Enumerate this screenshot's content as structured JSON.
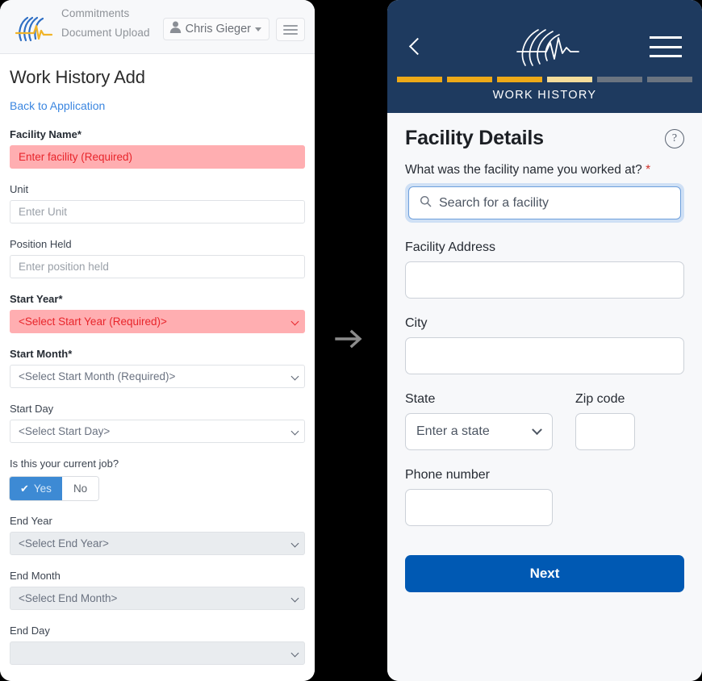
{
  "desktop": {
    "topbar": {
      "logo_name": "brand-logo",
      "nav_links": [
        {
          "label": "Commitments"
        },
        {
          "label": "Document Upload"
        }
      ],
      "user_name": "Chris Gieger",
      "menu_name": "menu-icon"
    },
    "page_title": "Work History Add",
    "back_link": "Back to Application",
    "fields": [
      {
        "label": "Facility Name",
        "required": true,
        "type": "text",
        "value": "",
        "placeholder": "Enter facility (Required)",
        "state": "error"
      },
      {
        "label": "Unit",
        "required": false,
        "type": "text",
        "value": "",
        "placeholder": "Enter Unit",
        "state": "normal"
      },
      {
        "label": "Position Held",
        "required": false,
        "type": "text",
        "value": "",
        "placeholder": "Enter position held",
        "state": "normal"
      },
      {
        "label": "Start Year",
        "required": true,
        "type": "select",
        "value": "<Select Start Year (Required)>",
        "state": "error"
      },
      {
        "label": "Start Month",
        "required": true,
        "type": "select",
        "value": "<Select Start Month (Required)>",
        "state": "normal"
      },
      {
        "label": "Start Day",
        "required": false,
        "type": "select",
        "value": "<Select Start Day>",
        "state": "normal"
      }
    ],
    "current_job": {
      "label": "Is this your current job?",
      "yes_label": "Yes",
      "no_label": "No",
      "selected": "Yes"
    },
    "end_fields": [
      {
        "label": "End Year",
        "type": "select",
        "value": "<Select End Year>",
        "state": "disabled"
      },
      {
        "label": "End Month",
        "type": "select",
        "value": "<Select End Month>",
        "state": "disabled"
      },
      {
        "label": "End Day",
        "type": "select",
        "value": "",
        "state": "disabled"
      }
    ],
    "required_marker": "*"
  },
  "transition": {
    "arrow_name": "right-arrow-icon",
    "arrow_color": "#8c8c8c",
    "background": "#000000"
  },
  "mobile": {
    "header": {
      "back_name": "back-chevron-icon",
      "logo_name": "brand-logo",
      "menu_name": "hamburger-menu-icon",
      "background": "#1e3a5f",
      "step_title": "WORK HISTORY",
      "progress": [
        {
          "state": "complete",
          "color": "#eda918"
        },
        {
          "state": "complete",
          "color": "#eda918"
        },
        {
          "state": "complete",
          "color": "#eda918"
        },
        {
          "state": "current",
          "color": "#f5dd9b"
        },
        {
          "state": "upcoming",
          "color": "#6b7480"
        },
        {
          "state": "upcoming",
          "color": "#6b7480"
        }
      ]
    },
    "section_title": "Facility Details",
    "help_icon_glyph": "?",
    "question": "What was the facility name you worked at?",
    "question_required_marker": "*",
    "search": {
      "icon_name": "search-icon",
      "placeholder": "Search for a facility",
      "value": "",
      "focused": true
    },
    "fields": [
      {
        "label": "Facility Address",
        "value": "",
        "type": "text"
      },
      {
        "label": "City",
        "value": "",
        "type": "text"
      }
    ],
    "state_field": {
      "label": "State",
      "value": "Enter a state",
      "type": "select"
    },
    "zip_field": {
      "label": "Zip code",
      "value": "",
      "type": "text"
    },
    "phone_field": {
      "label": "Phone number",
      "value": "",
      "type": "text"
    },
    "next_label": "Next",
    "next_color": "#0059b3"
  }
}
